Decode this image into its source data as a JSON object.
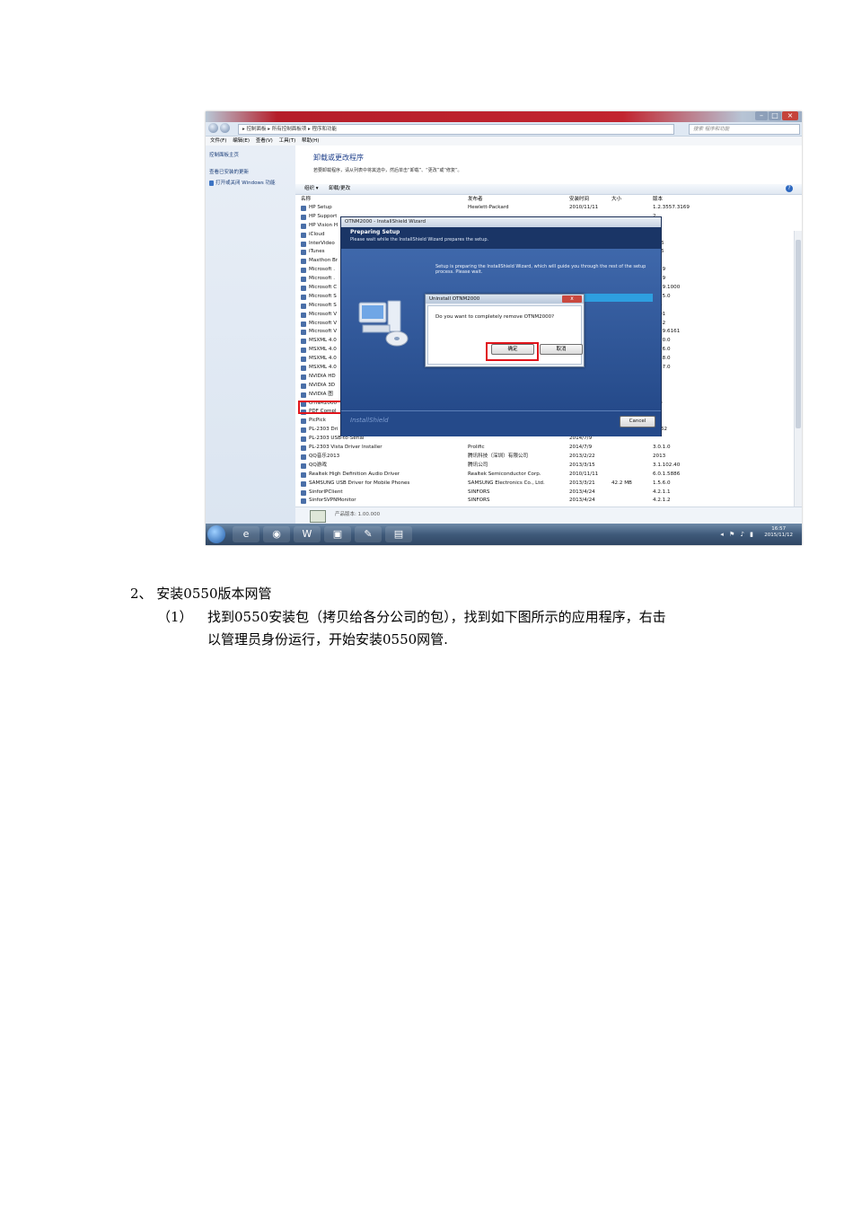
{
  "screenshot": {
    "window_buttons": [
      "–",
      "□",
      "×"
    ],
    "address": "▸ 控制面板 ▸ 所有控制面板项 ▸ 程序和功能",
    "search_placeholder": "搜索 程序和功能",
    "menu": [
      "文件(F)",
      "编辑(E)",
      "查看(V)",
      "工具(T)",
      "帮助(H)"
    ],
    "left_links": [
      "控制面板主页",
      "查看已安装的更新",
      "打开或关闭 Windows 功能"
    ],
    "heading": "卸载或更改程序",
    "subheading": "若要卸载程序，请从列表中将其选中，然后单击“卸载”、“更改”或“修复”。",
    "toolbar": [
      "组织 ▾",
      "卸载/更改"
    ],
    "columns": [
      "名称",
      "发布者",
      "安装时间",
      "大小",
      "版本"
    ],
    "programs": [
      {
        "name": "HP Setup",
        "publisher": "Hewlett-Packard",
        "date": "2010/11/11",
        "size": "",
        "version": "1.2.3557.3169"
      },
      {
        "name": "HP Support",
        "publisher": "",
        "date": "",
        "size": "",
        "version": "2"
      },
      {
        "name": "HP Vision H",
        "publisher": "",
        "date": "",
        "size": "",
        "version": "0"
      },
      {
        "name": "iCloud",
        "publisher": "",
        "date": "",
        "size": "",
        "version": "8"
      },
      {
        "name": "InterVideo",
        "publisher": "",
        "date": "",
        "size": "",
        "version": "0.36"
      },
      {
        "name": "iTunes",
        "publisher": "",
        "date": "",
        "size": "",
        "version": "2.26"
      },
      {
        "name": "Maxthon Br",
        "publisher": "",
        "date": "",
        "size": "",
        "version": ""
      },
      {
        "name": "Microsoft .",
        "publisher": "",
        "date": "",
        "size": "",
        "version": "0319"
      },
      {
        "name": "Microsoft .",
        "publisher": "",
        "date": "",
        "size": "",
        "version": "0319"
      },
      {
        "name": "Microsoft C",
        "publisher": "",
        "date": "",
        "size": "",
        "version": "6029.1000"
      },
      {
        "name": "Microsoft S",
        "publisher": "",
        "date": "",
        "size": "",
        "version": "0125.0"
      },
      {
        "name": "Microsoft S",
        "publisher": "",
        "date": "",
        "size": "",
        "version": "194"
      },
      {
        "name": "Microsoft V",
        "publisher": "",
        "date": "",
        "size": "",
        "version": "1001"
      },
      {
        "name": "Microsoft V",
        "publisher": "",
        "date": "",
        "size": "",
        "version": "1022"
      },
      {
        "name": "Microsoft V",
        "publisher": "",
        "date": "",
        "size": "",
        "version": "0729.6161"
      },
      {
        "name": "MSXML 4.0",
        "publisher": "",
        "date": "",
        "size": "",
        "version": "9870.0"
      },
      {
        "name": "MSXML 4.0",
        "publisher": "",
        "date": "",
        "size": "",
        "version": "9876.0"
      },
      {
        "name": "MSXML 4.0",
        "publisher": "",
        "date": "",
        "size": "",
        "version": "9818.0"
      },
      {
        "name": "MSXML 4.0",
        "publisher": "",
        "date": "",
        "size": "",
        "version": "2117.0"
      },
      {
        "name": "NVIDIA HD",
        "publisher": "",
        "date": "",
        "size": "",
        "version": "8.0"
      },
      {
        "name": "NVIDIA 3D",
        "publisher": "",
        "date": "",
        "size": "",
        "version": "8"
      },
      {
        "name": "NVIDIA 图",
        "publisher": "",
        "date": "",
        "size": "",
        "version": "93"
      },
      {
        "name": "OTNM2000",
        "publisher": "",
        "date": "",
        "size": "",
        "version": "000"
      },
      {
        "name": "PDF Compl",
        "publisher": "",
        "date": "",
        "size": "",
        "version": "09"
      },
      {
        "name": "PicPick",
        "publisher": "",
        "date": "",
        "size": "",
        "version": ""
      },
      {
        "name": "PL-2303 Dri",
        "publisher": "",
        "date": "",
        "size": "",
        "version": "0.162"
      },
      {
        "name": "PL-2303 USB-to-Serial",
        "publisher": "",
        "date": "2014/7/9",
        "size": "",
        "version": ""
      },
      {
        "name": "PL-2303 Vista Driver Installer",
        "publisher": "Prolific",
        "date": "2014/7/9",
        "size": "",
        "version": "3.0.1.0"
      },
      {
        "name": "QQ音乐2013",
        "publisher": "腾讯科技（深圳）有限公司",
        "date": "2013/2/22",
        "size": "",
        "version": "2013"
      },
      {
        "name": "QQ游戏",
        "publisher": "腾讯公司",
        "date": "2013/3/15",
        "size": "",
        "version": "3.1.102.40"
      },
      {
        "name": "Realtek High Definition Audio Driver",
        "publisher": "Realtek Semiconductor Corp.",
        "date": "2010/11/11",
        "size": "",
        "version": "6.0.1.5886"
      },
      {
        "name": "SAMSUNG USB Driver for Mobile Phones",
        "publisher": "SAMSUNG Electronics Co., Ltd.",
        "date": "2013/3/21",
        "size": "42.2 MB",
        "version": "1.5.6.0"
      },
      {
        "name": "SinforIPClient",
        "publisher": "SINFORS",
        "date": "2013/4/24",
        "size": "",
        "version": "4.2.1.1"
      },
      {
        "name": "SinforSVPNMonitor",
        "publisher": "SINFORS",
        "date": "2013/4/24",
        "size": "",
        "version": "4.2.1.2"
      }
    ],
    "wizard": {
      "title": "OTNM2000 - InstallShield Wizard",
      "head_title": "Preparing Setup",
      "head_sub": "Please wait while the InstallShield Wizard prepares the setup.",
      "body": "Setup is preparing the InstallShield Wizard, which will guide you through the rest of the setup process. Please wait.",
      "brand": "InstallShield",
      "cancel": "Cancel"
    },
    "dialog": {
      "title": "Uninstall OTNM2000",
      "close": "x",
      "message": "Do you want to completely remove OTNM2000?",
      "ok": "确定",
      "cancel": "取消"
    },
    "details": "产品版本: 1.00.000",
    "clock_time": "16:57",
    "clock_date": "2015/11/12"
  },
  "doc": {
    "step": "2、 安装0550版本网管",
    "sub_num": "（1）",
    "sub_line1": "找到0550安装包（拷贝给各分公司的包），找到如下图所示的应用程序，右击",
    "sub_line2": "以管理员身份运行，开始安装0550网管."
  }
}
